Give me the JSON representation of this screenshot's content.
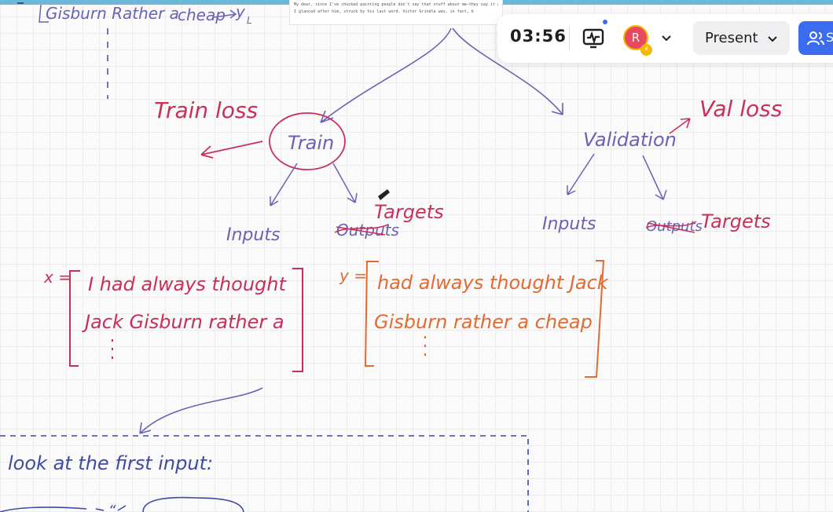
{
  "doc_snippet": {
    "line1": "My dear, since I've chucked painting people don't say that stuff about me—they say it about Victor Grindle,\" was his only protest.",
    "line2": "I glanced after him, struck by his last word. Victor Grindle was, in fact, b"
  },
  "board": {
    "top_note_left": "Gisburn Rather a",
    "top_note_cheap": "cheap",
    "top_note_yl": "y",
    "top_note_yl_sub": "L",
    "train_loss": "Train loss",
    "train": "Train",
    "validation": "Validation",
    "val_loss": "Val loss",
    "train_inputs": "Inputs",
    "train_outputs_struck": "Outputs",
    "train_targets": "Targets",
    "val_inputs": "Inputs",
    "val_outputs_struck": "Outputs",
    "val_targets": "Targets",
    "x_label": "x =",
    "x_row1": "I  had  always  thought",
    "x_row2": "Jack  Gisburn  rather   a",
    "y_label": "y =",
    "y_row1": "had  always  thought  Jack",
    "y_row2": "Gisburn  rather  a    cheap",
    "look_note": "look  at  the  first  input:",
    "bottom_fragment": "“"
  },
  "toolbar": {
    "timer": "03:56",
    "activity_icon": "activity-icon",
    "avatar_letter": "R",
    "avatar_badge_icon": "lightning-icon",
    "present_label": "Present",
    "share_label": "Share",
    "share_icon": "people-icon"
  },
  "colors": {
    "toolbar_bg": "#ffffff",
    "present_bg": "#f0f0f2",
    "share_bg": "#3b6cf0",
    "avatar_bg": "#e8495e",
    "avatar_ring": "#f5b800",
    "ink_blue": "#6a62b4",
    "ink_red": "#c8305a",
    "ink_orange": "#e36a30"
  }
}
